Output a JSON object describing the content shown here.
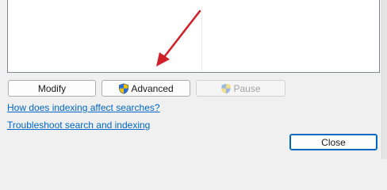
{
  "buttons": {
    "modify_label": "Modify",
    "advanced_label": "Advanced",
    "pause_label": "Pause",
    "close_label": "Close"
  },
  "links": {
    "indexing_affect": "How does indexing affect searches?",
    "troubleshoot": "Troubleshoot search and indexing"
  },
  "icons": {
    "advanced_icon": "uac-shield-icon",
    "pause_icon": "uac-shield-icon",
    "annotation": "red-arrow-icon"
  },
  "states": {
    "pause_enabled": false
  },
  "colors": {
    "link": "#0066cc",
    "annotation_arrow": "#d0202a",
    "close_focus_border": "#0067c0"
  }
}
